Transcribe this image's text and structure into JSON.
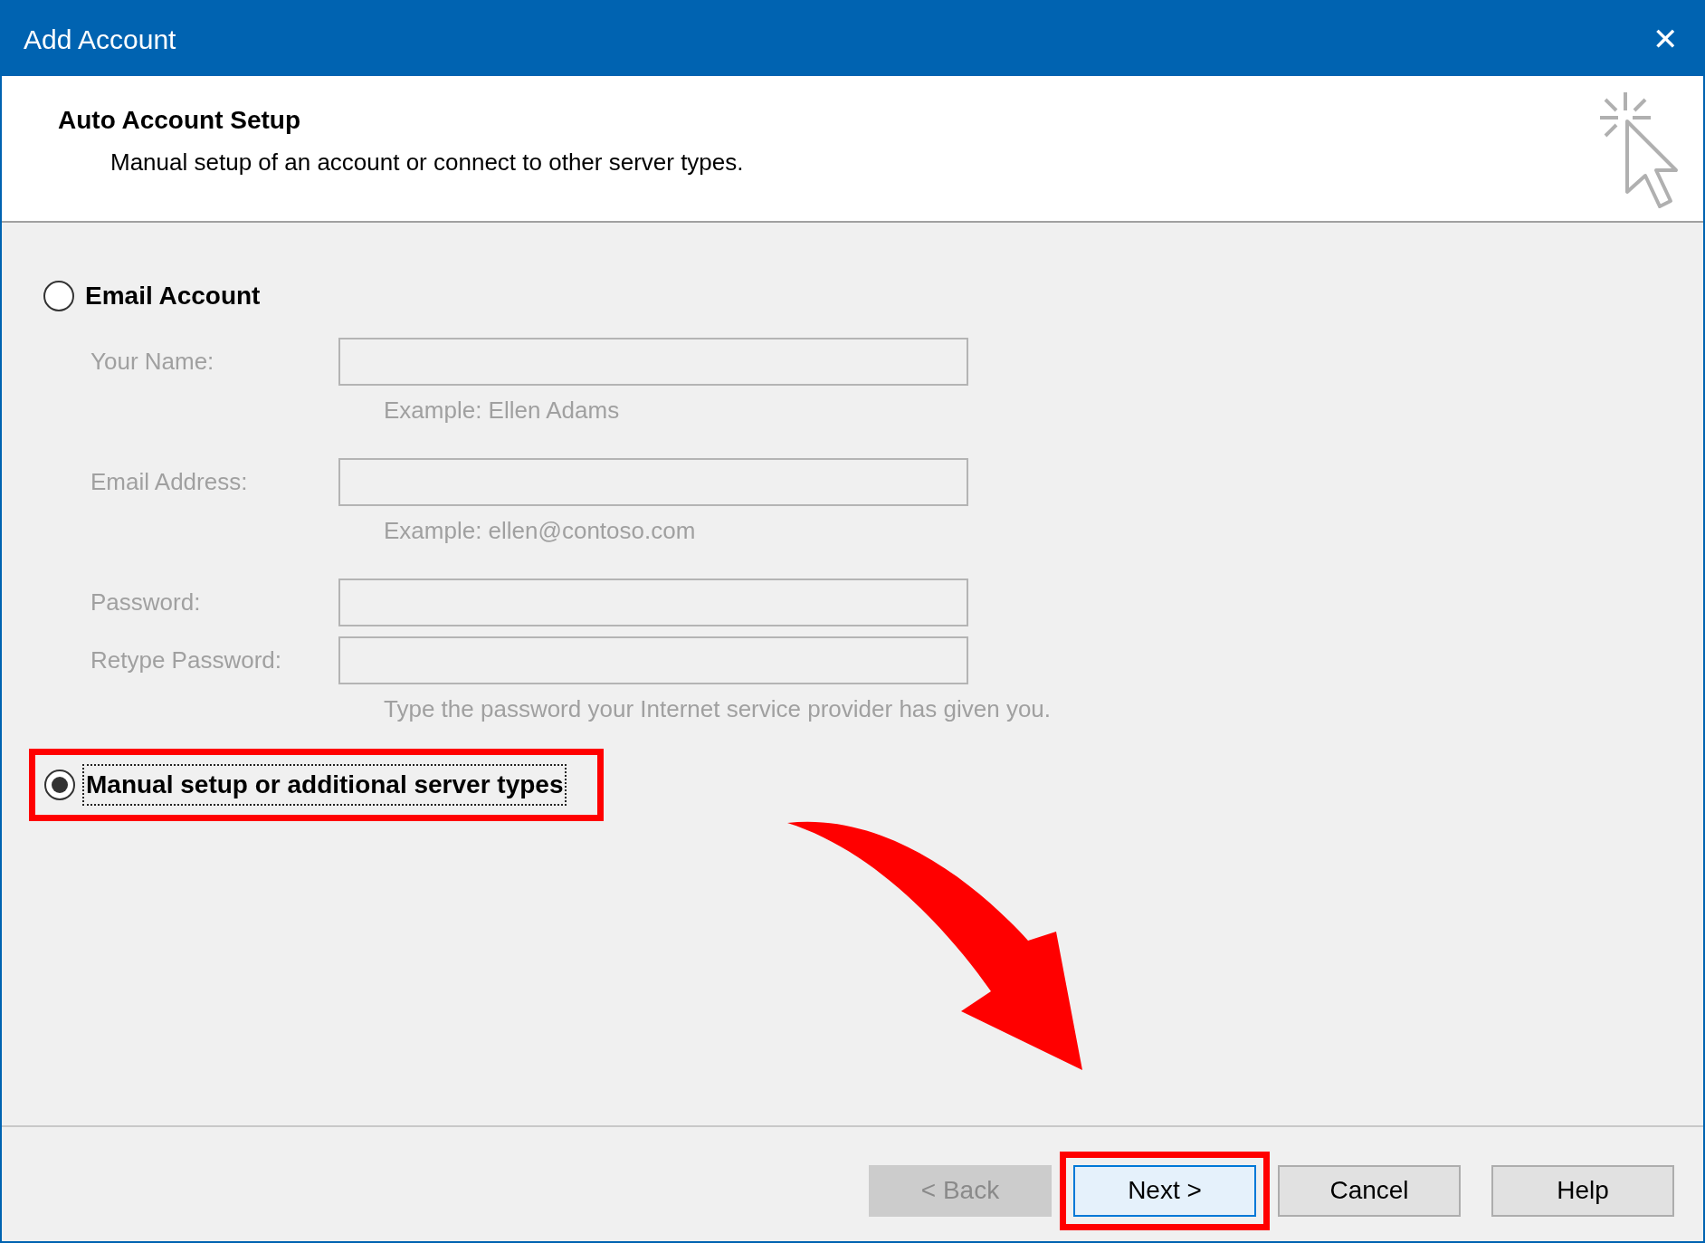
{
  "window": {
    "title": "Add Account",
    "close": "✕"
  },
  "header": {
    "title": "Auto Account Setup",
    "subtitle": "Manual setup of an account or connect to other server types."
  },
  "options": [
    {
      "label": "Email Account",
      "selected": false,
      "focused": false,
      "highlighted": false,
      "fields_disabled": true,
      "fields": [
        {
          "kind": "field",
          "label": "Your Name:",
          "hint": "Example: Ellen Adams"
        },
        {
          "kind": "field",
          "label": "Email Address:",
          "hint": "Example: ellen@contoso.com"
        },
        {
          "kind": "field",
          "label": "Password:"
        },
        {
          "kind": "field",
          "label": "Retype Password:",
          "hint": "Type the password your Internet service provider has given you."
        }
      ]
    },
    {
      "label": "Manual setup or additional server types",
      "selected": true,
      "focused": true,
      "highlighted": true
    }
  ],
  "buttons": [
    {
      "label": "< Back",
      "disabled": true,
      "default": false,
      "highlighted": false
    },
    {
      "label": "Next >",
      "disabled": false,
      "default": true,
      "highlighted": true
    },
    {
      "label": "Cancel",
      "disabled": false,
      "default": false,
      "highlighted": false
    },
    {
      "label": "Help",
      "disabled": false,
      "default": false,
      "highlighted": false
    }
  ],
  "callout_arrow": true
}
